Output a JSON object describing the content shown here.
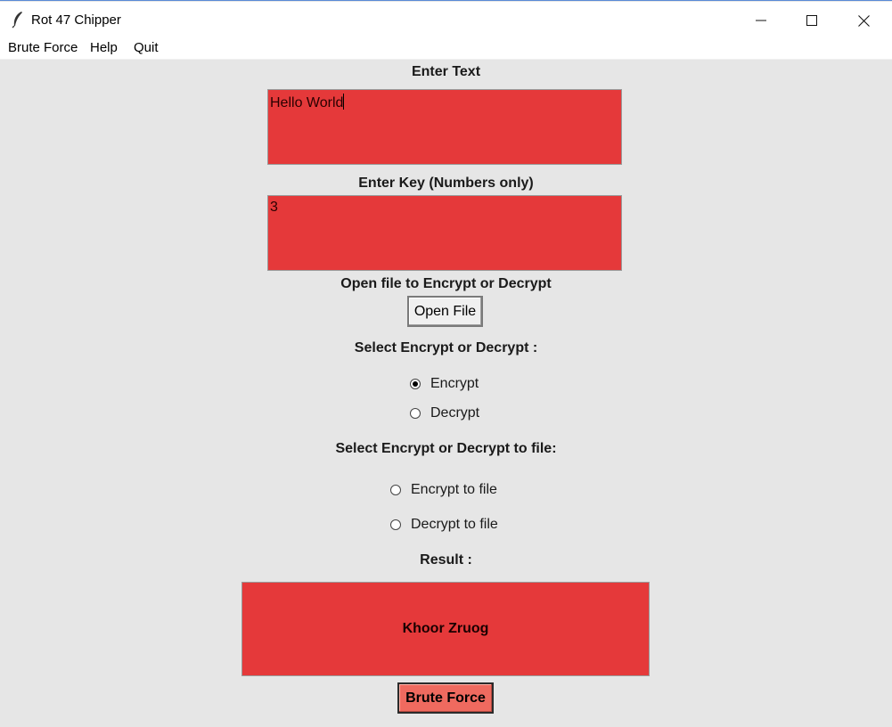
{
  "window": {
    "title": "Rot 47 Chipper"
  },
  "menu": {
    "items": [
      "Brute Force",
      "Help",
      "Quit"
    ]
  },
  "form": {
    "text_label": "Enter Text",
    "text_value": "Hello World",
    "key_label": "Enter Key (Numbers only)",
    "key_value": "3",
    "open_label": "Open file to Encrypt or Decrypt",
    "open_button": "Open File",
    "mode_label": "Select Encrypt or Decrypt :",
    "mode_options": [
      "Encrypt",
      "Decrypt"
    ],
    "mode_selected": "Encrypt",
    "file_mode_label": "Select Encrypt or Decrypt to file:",
    "file_mode_options": [
      "Encrypt to file",
      "Decrypt to file"
    ],
    "file_mode_selected": null,
    "result_label": "Result :",
    "result_value": "Khoor Zruog",
    "brute_button": "Brute Force"
  },
  "colors": {
    "field_bg": "#e5393a",
    "brute_button_bg": "#ef6a5f",
    "window_bg": "#e6e6e6"
  },
  "icons": {
    "app": "feather-icon",
    "minimize": "minimize-icon",
    "maximize": "maximize-icon",
    "close": "close-icon"
  }
}
